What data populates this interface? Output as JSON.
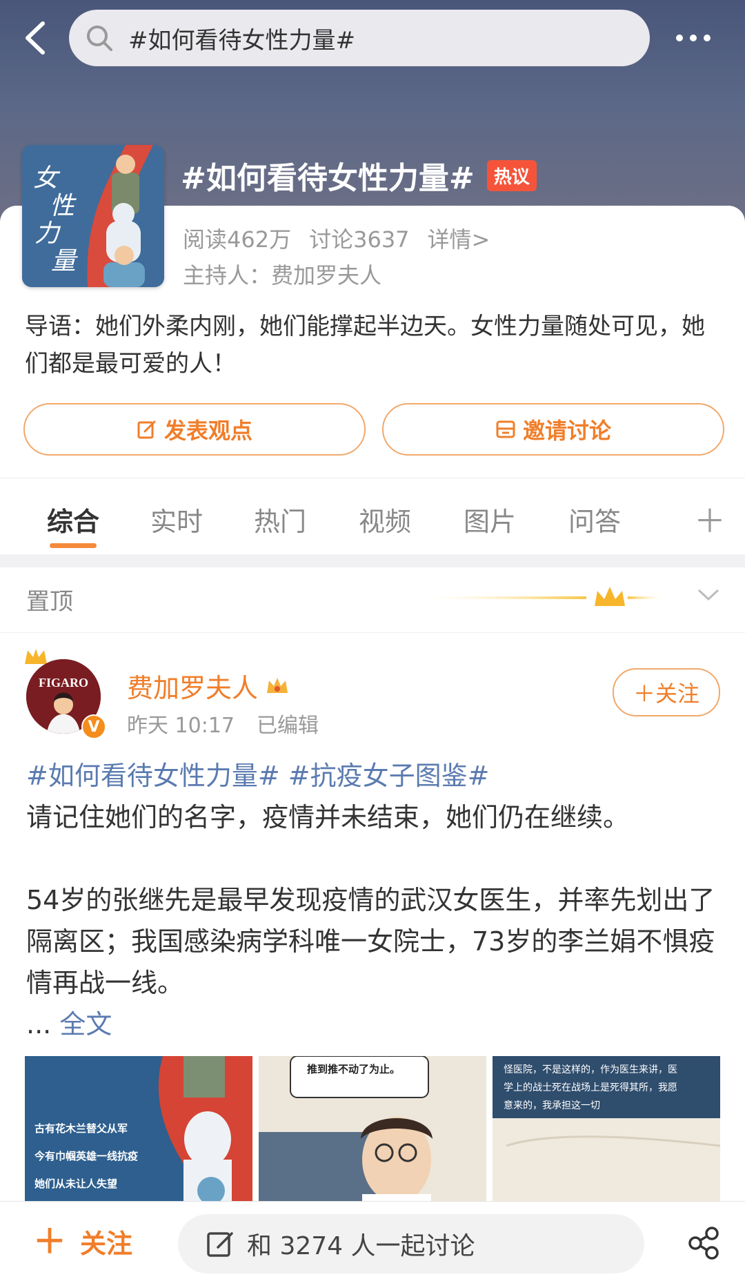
{
  "header": {
    "search_text": "#如何看待女性力量#"
  },
  "topic": {
    "cover_text": "女性力量",
    "title": "#如何看待女性力量#",
    "hot_badge": "热议",
    "reads": "阅读462万",
    "discussions": "讨论3637",
    "details": "详情>",
    "host": "主持人：费加罗夫人",
    "intro": "导语：她们外柔内刚，她们能撑起半边天。女性力量随处可见，她们都是最可爱的人！"
  },
  "actions": {
    "post_label": "发表观点",
    "invite_label": "邀请讨论"
  },
  "tabs": [
    "综合",
    "实时",
    "热门",
    "视频",
    "图片",
    "问答"
  ],
  "pinned": {
    "label": "置顶"
  },
  "post": {
    "avatar_text": "FIGARO",
    "author": "费加罗夫人",
    "time": "昨天 10:17",
    "edited": "已编辑",
    "follow_label": "＋关注",
    "tag1": "#如何看待女性力量#",
    "tag2": "#抗疫女子图鉴#",
    "line1": "请记住她们的名字，疫情并未结束，她们仍在继续。",
    "para2": "54岁的张继先是最早发现疫情的武汉女医生，并率先划出了隔离区；我国感染病学科唯一女院士，73岁的李兰娟不惧疫情再战一线。",
    "ellipsis": "...",
    "full_text": "全文",
    "images": [
      {
        "lines": [
          "古有花木兰替父从军",
          "今有巾帼英雄一线抗疫",
          "她们从未让人失望"
        ]
      },
      {
        "bubble": "推到推不动了为止。"
      },
      {
        "lines": [
          "怪医院，不是这样的，作为医生来讲，医",
          "学上的战士死在战场上是死得其所，我愿",
          "意来的，我承担这一切"
        ]
      }
    ]
  },
  "bottom": {
    "follow_label": "关注",
    "discuss_label": "和 3274 人一起讨论"
  },
  "colors": {
    "accent": "#f07e2a",
    "link": "#5b7bb0",
    "hot": "#f5543a"
  }
}
